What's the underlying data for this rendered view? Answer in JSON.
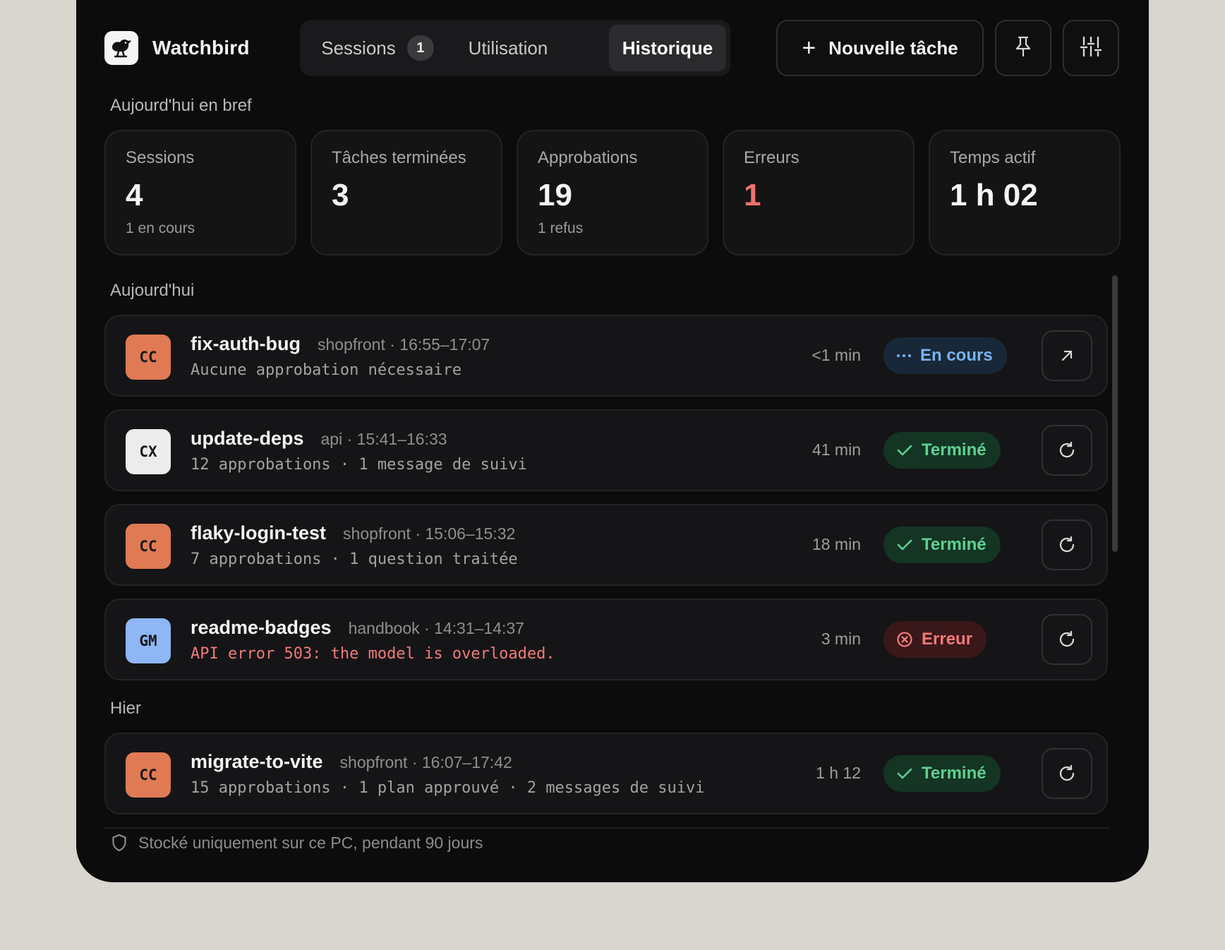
{
  "app": {
    "name": "Watchbird"
  },
  "tabs": [
    {
      "label": "Sessions",
      "badge": "1"
    },
    {
      "label": "Utilisation"
    },
    {
      "label": "Historique",
      "active": true
    }
  ],
  "toolbar": {
    "new_task_label": "Nouvelle tâche"
  },
  "summary": {
    "title": "Aujourd'hui en bref",
    "stats": [
      {
        "label": "Sessions",
        "value": "4",
        "sub": "1 en cours"
      },
      {
        "label": "Tâches terminées",
        "value": "3",
        "sub": ""
      },
      {
        "label": "Approbations",
        "value": "19",
        "sub": "1 refus"
      },
      {
        "label": "Erreurs",
        "value": "1",
        "sub": ""
      },
      {
        "label": "Temps actif",
        "value": "1 h 02",
        "sub": ""
      }
    ]
  },
  "groups": {
    "today": "Aujourd'hui",
    "yesterday": "Hier"
  },
  "sessions": [
    {
      "avatar": "CC",
      "title": "fix-auth-bug",
      "meta": "shopfront · 16:55–17:07",
      "detail": "Aucune approbation nécessaire",
      "duration": "<1 min",
      "status": "En cours"
    },
    {
      "avatar": "CX",
      "title": "update-deps",
      "meta": "api · 15:41–16:33",
      "detail": "12 approbations · 1 message de suivi",
      "duration": "41 min",
      "status": "Terminé"
    },
    {
      "avatar": "CC",
      "title": "flaky-login-test",
      "meta": "shopfront · 15:06–15:32",
      "detail": "7 approbations · 1 question traitée",
      "duration": "18 min",
      "status": "Terminé"
    },
    {
      "avatar": "GM",
      "title": "readme-badges",
      "meta": "handbook · 14:31–14:37",
      "detail": "API error 503: the model is overloaded.",
      "duration": "3 min",
      "status": "Erreur"
    },
    {
      "avatar": "CC",
      "title": "migrate-to-vite",
      "meta": "shopfront · 16:07–17:42",
      "detail": "15 approbations · 1 plan approuvé · 2 messages de suivi",
      "duration": "1 h 12",
      "status": "Terminé"
    }
  ],
  "footer": {
    "text": "Stocké uniquement sur ce PC, pendant 90 jours"
  },
  "colors": {
    "avatar_cc": "#e07a55",
    "avatar_cx": "#ececec",
    "avatar_gm": "#8fb6f5",
    "running": "#7ab2ee",
    "done": "#5fd08f",
    "error": "#f07171"
  }
}
